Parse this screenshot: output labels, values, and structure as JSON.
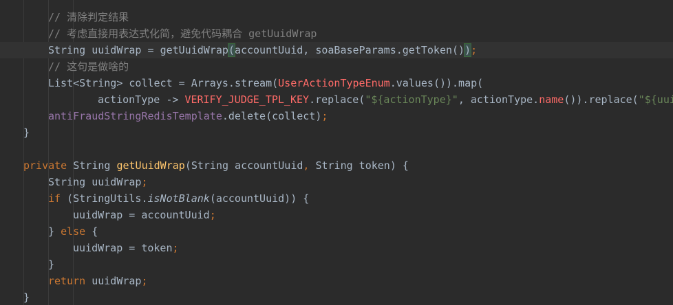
{
  "lines": [
    {
      "indent": 2,
      "tokens": [
        {
          "t": "// 清除判定结果",
          "c": "cmt"
        }
      ]
    },
    {
      "indent": 2,
      "tokens": [
        {
          "t": "// 考虑直接用表达式化简，避免代码耦合 getUuidWrap",
          "c": "cmt"
        }
      ]
    },
    {
      "indent": 2,
      "current": true,
      "tokens": [
        {
          "t": "String uuidWrap = ",
          "c": "txt"
        },
        {
          "t": "getUuidWrap",
          "c": "txt"
        },
        {
          "t": "(",
          "c": "brace-hl"
        },
        {
          "t": "accountUuid, soaBaseParams.getToken()",
          "c": "txt"
        },
        {
          "t": ")",
          "c": "brace-hl"
        },
        {
          "t": ";",
          "c": "kw"
        }
      ]
    },
    {
      "indent": 2,
      "tokens": [
        {
          "t": "// 这句是做啥的",
          "c": "cmt"
        }
      ]
    },
    {
      "indent": 2,
      "tokens": [
        {
          "t": "List<String> collect = Arrays.",
          "c": "txt"
        },
        {
          "t": "stream",
          "c": "txt"
        },
        {
          "t": "(",
          "c": "txt"
        },
        {
          "t": "UserActionTypeEnum",
          "c": "cls"
        },
        {
          "t": ".",
          "c": "txt"
        },
        {
          "t": "values",
          "c": "txt"
        },
        {
          "t": "()).map(",
          "c": "txt"
        }
      ]
    },
    {
      "indent": 4,
      "tokens": [
        {
          "t": "actionType -> ",
          "c": "txt"
        },
        {
          "t": "VERIFY_JUDGE_TPL_KEY",
          "c": "const"
        },
        {
          "t": ".replace(",
          "c": "txt"
        },
        {
          "t": "\"${actionType}\"",
          "c": "str"
        },
        {
          "t": ", actionType.",
          "c": "txt"
        },
        {
          "t": "name",
          "c": "const"
        },
        {
          "t": "()).replace(",
          "c": "txt"
        },
        {
          "t": "\"${uuidWrap}\"",
          "c": "str"
        }
      ]
    },
    {
      "indent": 2,
      "tokens": [
        {
          "t": "antiFraudStringRedisTemplate",
          "c": "field"
        },
        {
          "t": ".delete(collect)",
          "c": "txt"
        },
        {
          "t": ";",
          "c": "kw"
        }
      ]
    },
    {
      "indent": 1,
      "tokens": [
        {
          "t": "}",
          "c": "txt"
        }
      ]
    },
    {
      "indent": 0,
      "tokens": []
    },
    {
      "indent": 1,
      "tokens": [
        {
          "t": "private ",
          "c": "kw"
        },
        {
          "t": "String ",
          "c": "txt"
        },
        {
          "t": "getUuidWrap",
          "c": "fn"
        },
        {
          "t": "(String accountUuid",
          "c": "txt"
        },
        {
          "t": ", ",
          "c": "kw"
        },
        {
          "t": "String token) {",
          "c": "txt"
        }
      ]
    },
    {
      "indent": 2,
      "tokens": [
        {
          "t": "String uuidWrap",
          "c": "txt"
        },
        {
          "t": ";",
          "c": "kw"
        }
      ]
    },
    {
      "indent": 2,
      "tokens": [
        {
          "t": "if ",
          "c": "kw"
        },
        {
          "t": "(StringUtils.",
          "c": "txt"
        },
        {
          "t": "isNotBlank",
          "c": "txt ital"
        },
        {
          "t": "(accountUuid)) {",
          "c": "txt"
        }
      ]
    },
    {
      "indent": 3,
      "tokens": [
        {
          "t": "uuidWrap = accountUuid",
          "c": "txt"
        },
        {
          "t": ";",
          "c": "kw"
        }
      ]
    },
    {
      "indent": 2,
      "tokens": [
        {
          "t": "} ",
          "c": "txt"
        },
        {
          "t": "else ",
          "c": "kw"
        },
        {
          "t": "{",
          "c": "txt"
        }
      ]
    },
    {
      "indent": 3,
      "tokens": [
        {
          "t": "uuidWrap = token",
          "c": "txt"
        },
        {
          "t": ";",
          "c": "kw"
        }
      ]
    },
    {
      "indent": 2,
      "tokens": [
        {
          "t": "}",
          "c": "txt"
        }
      ]
    },
    {
      "indent": 2,
      "tokens": [
        {
          "t": "return ",
          "c": "kw"
        },
        {
          "t": "uuidWrap",
          "c": "txt"
        },
        {
          "t": ";",
          "c": "kw"
        }
      ]
    },
    {
      "indent": 1,
      "tokens": [
        {
          "t": "}",
          "c": "txt"
        }
      ]
    }
  ]
}
